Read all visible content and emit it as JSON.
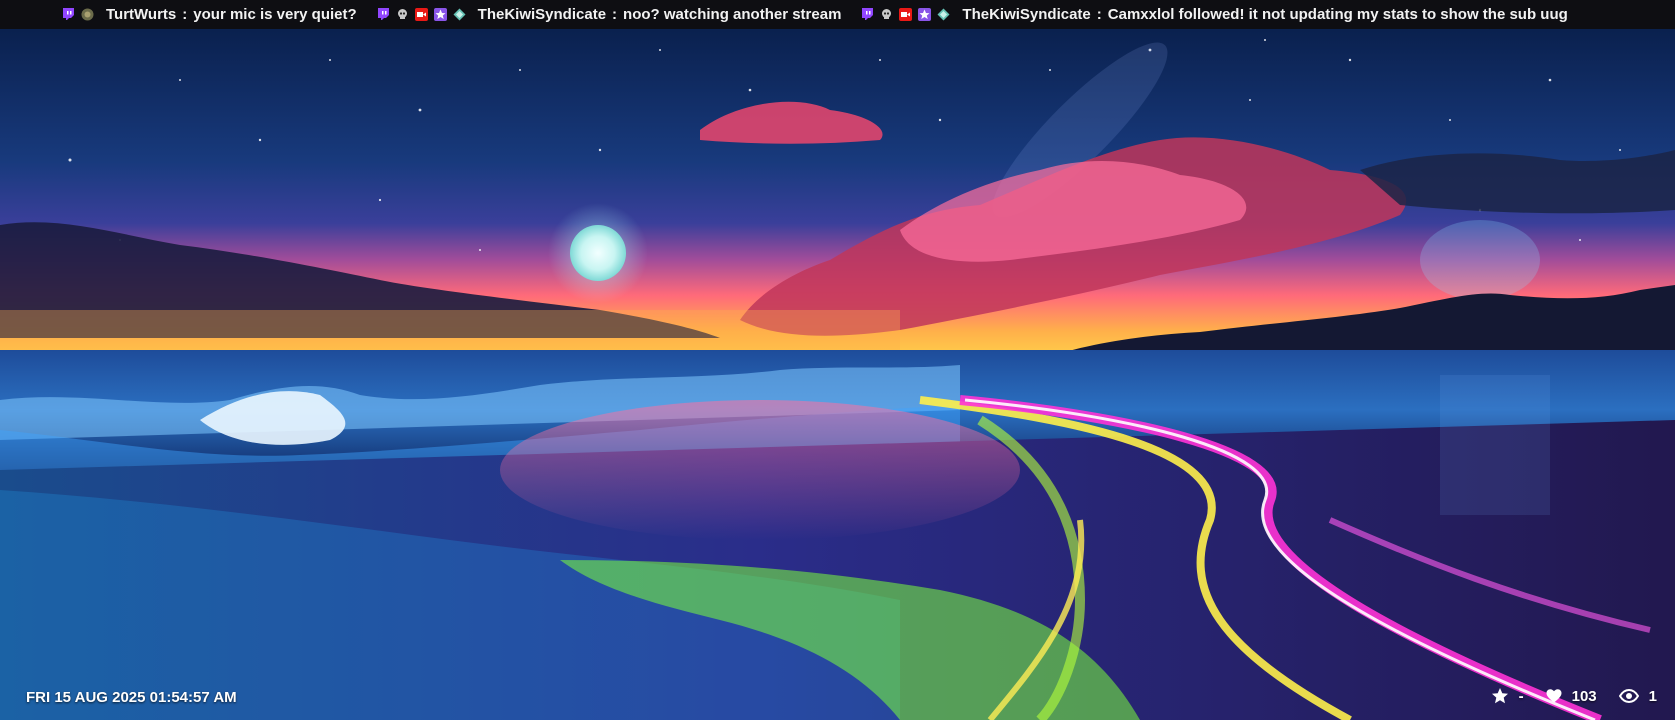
{
  "chat_ticker": {
    "messages": [
      {
        "user": "TurtWurts",
        "separator": ":",
        "text": "your mic is very quiet?",
        "badges": [
          "twitch-icon",
          "avatar-badge-icon"
        ]
      },
      {
        "user": "TheKiwiSyndicate",
        "separator": ":",
        "text": "noo?  watching another stream",
        "badges": [
          "twitch-icon",
          "skull-icon",
          "video-badge-icon",
          "star-badge-icon",
          "gem-badge-icon"
        ]
      },
      {
        "user": "TheKiwiSyndicate",
        "separator": ":",
        "text": "Camxxlol followed!  it not updating my stats to show the sub uug",
        "badges": [
          "twitch-icon",
          "skull-icon",
          "video-badge-icon",
          "star-badge-icon",
          "gem-badge-icon"
        ]
      }
    ]
  },
  "status_bar": {
    "datetime": "FRI 15 AUG 2025 01:54:57 AM",
    "star_value": "-",
    "likes": "103",
    "viewers": "1"
  },
  "colors": {
    "twitch_purple": "#9146ff",
    "ticker_bg": "#0e0e12",
    "video_red": "#e91916",
    "star_purple": "#8a55e8",
    "gem_teal": "#66c2b5"
  }
}
